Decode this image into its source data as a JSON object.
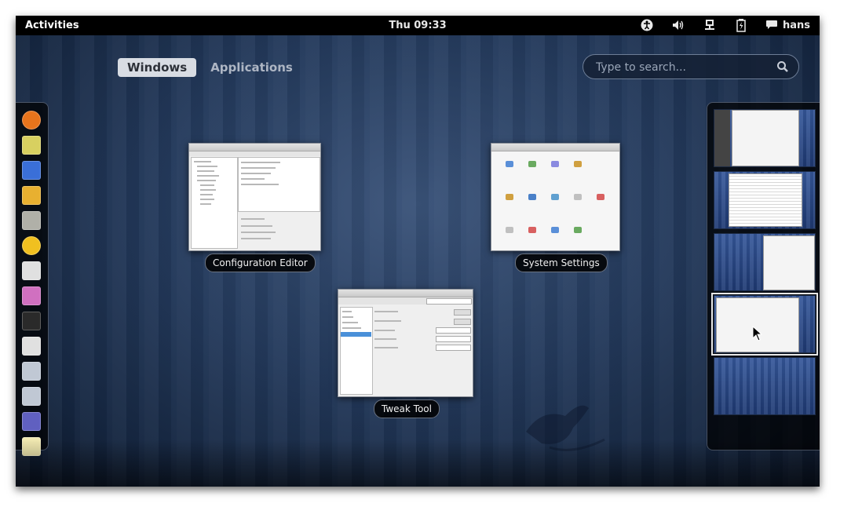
{
  "topbar": {
    "activities_label": "Activities",
    "clock": "Thu 09:33",
    "user_name": "hans",
    "tray_icons": [
      "accessibility-icon",
      "volume-icon",
      "network-icon",
      "battery-icon",
      "chat-bubble-icon"
    ]
  },
  "view_tabs": [
    {
      "label": "Windows",
      "active": true
    },
    {
      "label": "Applications",
      "active": false
    }
  ],
  "search": {
    "placeholder": "Type to search..."
  },
  "dash": {
    "icons": [
      "firefox-icon",
      "archive-manager-icon",
      "remote-desktop-icon",
      "file-manager-icon",
      "printer-icon",
      "cd-burner-icon",
      "scanner-icon",
      "text-editor-icon",
      "terminal-icon",
      "usb-device-icon",
      "tools-icon",
      "tools-icon",
      "monitor-icon",
      "notes-icon"
    ],
    "colors": [
      "#e8741c",
      "#d8d060",
      "#3a6fd8",
      "#e8b030",
      "#b0b0a8",
      "#f0c020",
      "#e0e0e0",
      "#d070c0",
      "#2a2a2a",
      "#e0e0e0",
      "#c0c8d4",
      "#c0c8d4",
      "#6060c0",
      "#f0e8b0"
    ]
  },
  "windows": [
    {
      "label": "Configuration Editor"
    },
    {
      "label": "System Settings"
    },
    {
      "label": "Tweak Tool"
    }
  ],
  "workspaces": [
    {
      "active": false
    },
    {
      "active": false
    },
    {
      "active": false
    },
    {
      "active": true
    },
    {
      "active": false
    }
  ]
}
